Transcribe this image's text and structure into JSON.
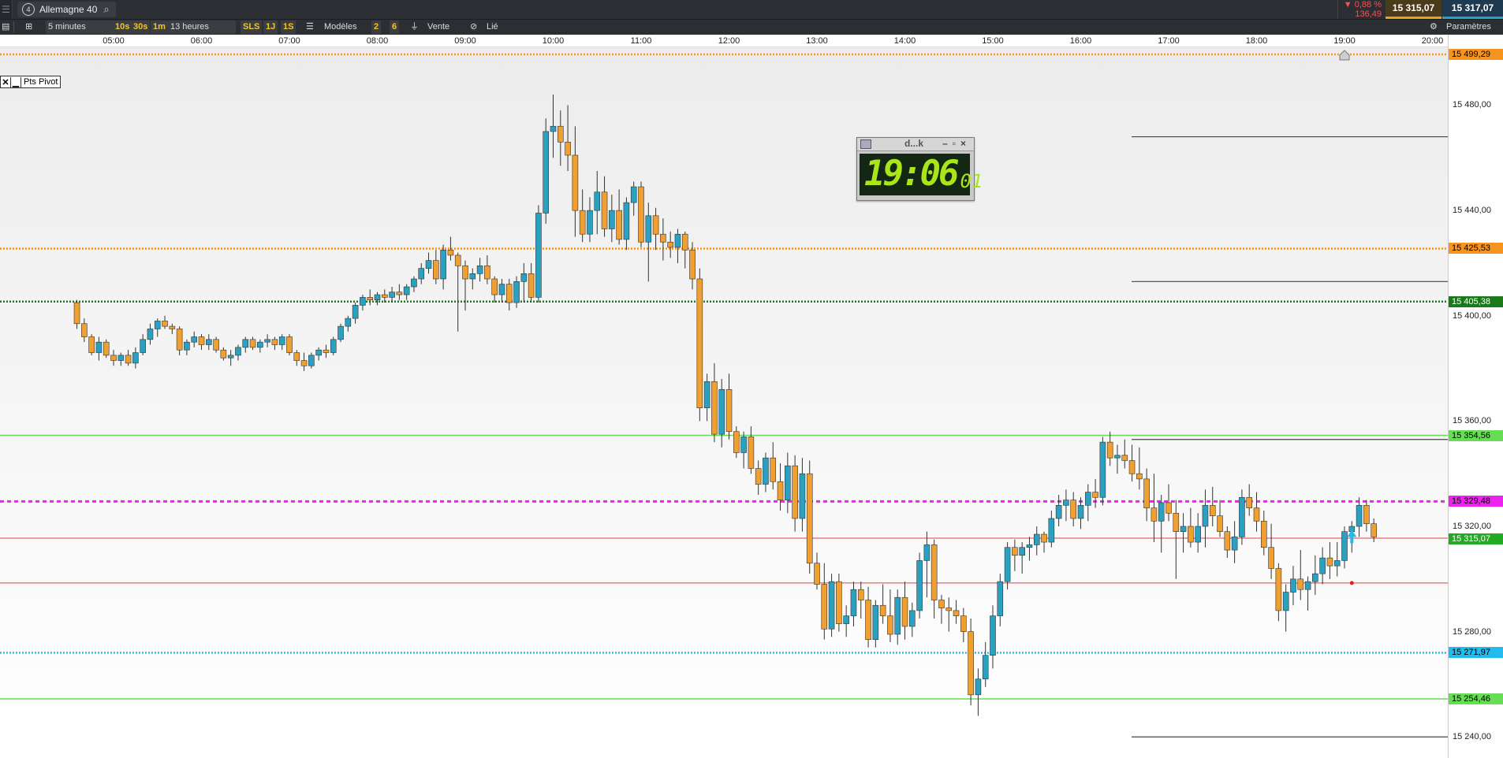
{
  "header": {
    "instrument": "Allemagne 40",
    "instrument_badge": "4",
    "change_pct": "▼ 0,88 %",
    "change_abs": "136,49",
    "bid": "15 315,07",
    "ask": "15 317,07"
  },
  "toolbar": {
    "timeframe": "5 minutes",
    "q10s": "10s",
    "q30s": "30s",
    "q1m": "1m",
    "duration": "13 heures",
    "sls": "SLS",
    "q1j": "1J",
    "q1s": "1S",
    "models": "Modèles",
    "n2": "2",
    "n6": "6",
    "sell": "Vente",
    "linked": "Lié",
    "settings": "Paramètres"
  },
  "pivot_legend": {
    "close": "✕",
    "minimize": "▁",
    "label": "Pts Pivot"
  },
  "clock": {
    "title": "d...k",
    "time": "19:06",
    "seconds": "01"
  },
  "colors": {
    "up": "#2aa1c0",
    "down": "#f0a030",
    "bullish_body": "#2aa1c0",
    "bearish_body": "#f0a030"
  },
  "chart_data": {
    "type": "candlestick",
    "title": "Allemagne 40",
    "timeframe": "5 minutes",
    "x_ticks": [
      "05:00",
      "06:00",
      "07:00",
      "08:00",
      "09:00",
      "10:00",
      "11:00",
      "12:00",
      "13:00",
      "14:00",
      "15:00",
      "16:00",
      "17:00",
      "18:00",
      "19:00",
      "20:00"
    ],
    "y_ticks": [
      "15 480,00",
      "15 440,00",
      "15 400,00",
      "15 360,00",
      "15 320,00",
      "15 280,00",
      "15 240,00"
    ],
    "ylim": [
      15232,
      15502
    ],
    "levels": [
      {
        "label": "15 499,29",
        "value": 15499.29,
        "color": "#f7941d",
        "style": "dotted",
        "text": "#000"
      },
      {
        "label": "15 425,53",
        "value": 15425.53,
        "color": "#f7941d",
        "style": "dotted",
        "text": "#000"
      },
      {
        "label": "15 405,38",
        "value": 15405.38,
        "color": "#1a7a1a",
        "style": "dotted",
        "text": "#fff"
      },
      {
        "label": "15 354,56",
        "value": 15354.56,
        "color": "#66dd55",
        "style": "solid",
        "text": "#000"
      },
      {
        "label": "15 329,48",
        "value": 15329.48,
        "color": "#ee22ee",
        "style": "dashed",
        "text": "#000"
      },
      {
        "label": "15 315,07",
        "value": 15315.07,
        "color": "#22aa22",
        "style": "current",
        "text": "#fff"
      },
      {
        "label": "15 271,97",
        "value": 15271.97,
        "color": "#22bbee",
        "style": "dotted",
        "text": "#000"
      },
      {
        "label": "15 254,46",
        "value": 15254.46,
        "color": "#66dd55",
        "style": "solid",
        "text": "#000"
      }
    ],
    "hlines": [
      {
        "value": 15315.5,
        "color": "#e04040"
      },
      {
        "value": 15298.5,
        "color": "#e04040"
      }
    ],
    "forecast_lines": [
      15468,
      15413,
      15353,
      15240
    ],
    "candles": [
      [
        "04:35",
        15405,
        15406,
        15395,
        15397
      ],
      [
        "04:40",
        15397,
        15399,
        15390,
        15392
      ],
      [
        "04:45",
        15392,
        15393,
        15385,
        15386
      ],
      [
        "04:50",
        15386,
        15392,
        15383,
        15390
      ],
      [
        "04:55",
        15390,
        15391,
        15384,
        15385
      ],
      [
        "05:00",
        15385,
        15387,
        15381,
        15383
      ],
      [
        "05:05",
        15383,
        15386,
        15381,
        15385
      ],
      [
        "05:10",
        15385,
        15387,
        15381,
        15382
      ],
      [
        "05:15",
        15382,
        15388,
        15380,
        15386
      ],
      [
        "05:20",
        15386,
        15393,
        15385,
        15391
      ],
      [
        "05:25",
        15391,
        15397,
        15389,
        15395
      ],
      [
        "05:30",
        15395,
        15399,
        15392,
        15398
      ],
      [
        "05:35",
        15398,
        15400,
        15395,
        15396
      ],
      [
        "05:40",
        15396,
        15397,
        15393,
        15395
      ],
      [
        "05:45",
        15395,
        15396,
        15385,
        15387
      ],
      [
        "05:50",
        15387,
        15391,
        15385,
        15390
      ],
      [
        "05:55",
        15390,
        15394,
        15388,
        15392
      ],
      [
        "06:00",
        15392,
        15393,
        15387,
        15389
      ],
      [
        "06:05",
        15389,
        15393,
        15387,
        15391
      ],
      [
        "06:10",
        15391,
        15392,
        15386,
        15387
      ],
      [
        "06:15",
        15387,
        15388,
        15383,
        15384
      ],
      [
        "06:20",
        15384,
        15387,
        15381,
        15385
      ],
      [
        "06:25",
        15385,
        15389,
        15383,
        15388
      ],
      [
        "06:30",
        15388,
        15392,
        15386,
        15391
      ],
      [
        "06:35",
        15391,
        15392,
        15387,
        15388
      ],
      [
        "06:40",
        15388,
        15391,
        15386,
        15390
      ],
      [
        "06:45",
        15390,
        15393,
        15388,
        15391
      ],
      [
        "06:50",
        15391,
        15392,
        15387,
        15389
      ],
      [
        "06:55",
        15389,
        15393,
        15387,
        15392
      ],
      [
        "07:00",
        15392,
        15393,
        15385,
        15386
      ],
      [
        "07:05",
        15386,
        15387,
        15381,
        15383
      ],
      [
        "07:10",
        15383,
        15386,
        15379,
        15381
      ],
      [
        "07:15",
        15381,
        15386,
        15380,
        15385
      ],
      [
        "07:20",
        15385,
        15388,
        15383,
        15387
      ],
      [
        "07:25",
        15387,
        15389,
        15384,
        15386
      ],
      [
        "07:30",
        15386,
        15392,
        15385,
        15391
      ],
      [
        "07:35",
        15391,
        15397,
        15390,
        15396
      ],
      [
        "07:40",
        15396,
        15400,
        15394,
        15399
      ],
      [
        "07:45",
        15399,
        15405,
        15397,
        15404
      ],
      [
        "07:50",
        15404,
        15408,
        15402,
        15407
      ],
      [
        "07:55",
        15407,
        15410,
        15404,
        15406
      ],
      [
        "08:00",
        15406,
        15409,
        15404,
        15408
      ],
      [
        "08:05",
        15408,
        15410,
        15405,
        15407
      ],
      [
        "08:10",
        15407,
        15411,
        15405,
        15409
      ],
      [
        "08:15",
        15409,
        15412,
        15406,
        15408
      ],
      [
        "08:20",
        15408,
        15412,
        15406,
        15411
      ],
      [
        "08:25",
        15411,
        15415,
        15409,
        15414
      ],
      [
        "08:30",
        15414,
        15420,
        15412,
        15418
      ],
      [
        "08:35",
        15418,
        15424,
        15416,
        15421
      ],
      [
        "08:40",
        15421,
        15425,
        15412,
        15414
      ],
      [
        "08:45",
        15414,
        15427,
        15410,
        15425
      ],
      [
        "08:50",
        15425,
        15430,
        15421,
        15423
      ],
      [
        "08:55",
        15423,
        15424,
        15394,
        15419
      ],
      [
        "09:00",
        15419,
        15421,
        15402,
        15414
      ],
      [
        "09:05",
        15414,
        15418,
        15410,
        15416
      ],
      [
        "09:10",
        15416,
        15422,
        15413,
        15419
      ],
      [
        "09:15",
        15419,
        15423,
        15412,
        15414
      ],
      [
        "09:20",
        15414,
        15415,
        15405,
        15408
      ],
      [
        "09:25",
        15408,
        15414,
        15405,
        15412
      ],
      [
        "09:30",
        15412,
        15414,
        15402,
        15405
      ],
      [
        "09:35",
        15405,
        15415,
        15403,
        15413
      ],
      [
        "09:40",
        15413,
        15420,
        15405,
        15416
      ],
      [
        "09:45",
        15416,
        15420,
        15405,
        15407
      ],
      [
        "09:50",
        15407,
        15442,
        15405,
        15439
      ],
      [
        "09:55",
        15439,
        15475,
        15435,
        15470
      ],
      [
        "10:00",
        15470,
        15484,
        15460,
        15472
      ],
      [
        "10:05",
        15472,
        15478,
        15457,
        15466
      ],
      [
        "10:10",
        15466,
        15480,
        15455,
        15461
      ],
      [
        "10:15",
        15461,
        15472,
        15430,
        15440
      ],
      [
        "10:20",
        15440,
        15448,
        15428,
        15431
      ],
      [
        "10:25",
        15431,
        15445,
        15428,
        15440
      ],
      [
        "10:30",
        15440,
        15455,
        15431,
        15447
      ],
      [
        "10:35",
        15447,
        15453,
        15430,
        15433
      ],
      [
        "10:40",
        15433,
        15446,
        15428,
        15440
      ],
      [
        "10:45",
        15440,
        15448,
        15427,
        15429
      ],
      [
        "10:50",
        15429,
        15445,
        15425,
        15443
      ],
      [
        "10:55",
        15443,
        15451,
        15438,
        15449
      ],
      [
        "11:00",
        15449,
        15451,
        15426,
        15428
      ],
      [
        "11:05",
        15428,
        15443,
        15413,
        15438
      ],
      [
        "11:10",
        15438,
        15441,
        15425,
        15431
      ],
      [
        "11:15",
        15431,
        15437,
        15421,
        15428
      ],
      [
        "11:20",
        15428,
        15432,
        15422,
        15426
      ],
      [
        "11:25",
        15426,
        15433,
        15420,
        15431
      ],
      [
        "11:30",
        15431,
        15432,
        15418,
        15425
      ],
      [
        "11:35",
        15425,
        15428,
        15410,
        15414
      ],
      [
        "11:40",
        15414,
        15418,
        15360,
        15365
      ],
      [
        "11:45",
        15365,
        15378,
        15360,
        15375
      ],
      [
        "11:50",
        15375,
        15382,
        15352,
        15355
      ],
      [
        "11:55",
        15355,
        15376,
        15350,
        15372
      ],
      [
        "12:00",
        15372,
        15378,
        15353,
        15356
      ],
      [
        "12:05",
        15356,
        15358,
        15346,
        15348
      ],
      [
        "12:10",
        15348,
        15356,
        15342,
        15354
      ],
      [
        "12:15",
        15354,
        15358,
        15340,
        15342
      ],
      [
        "12:20",
        15342,
        15345,
        15332,
        15336
      ],
      [
        "12:25",
        15336,
        15348,
        15333,
        15346
      ],
      [
        "12:30",
        15346,
        15352,
        15334,
        15337
      ],
      [
        "12:35",
        15337,
        15344,
        15326,
        15330
      ],
      [
        "12:40",
        15330,
        15348,
        15325,
        15343
      ],
      [
        "12:45",
        15343,
        15347,
        15318,
        15323
      ],
      [
        "12:50",
        15323,
        15346,
        15318,
        15340
      ],
      [
        "12:55",
        15340,
        15345,
        15302,
        15306
      ],
      [
        "13:00",
        15306,
        15310,
        15296,
        15298
      ],
      [
        "13:05",
        15298,
        15306,
        15277,
        15281
      ],
      [
        "13:10",
        15281,
        15302,
        15278,
        15299
      ],
      [
        "13:15",
        15299,
        15302,
        15280,
        15283
      ],
      [
        "13:20",
        15283,
        15290,
        15278,
        15286
      ],
      [
        "13:25",
        15286,
        15299,
        15282,
        15296
      ],
      [
        "13:30",
        15296,
        15299,
        15285,
        15292
      ],
      [
        "13:35",
        15292,
        15297,
        15274,
        15277
      ],
      [
        "13:40",
        15277,
        15292,
        15274,
        15290
      ],
      [
        "13:45",
        15290,
        15298,
        15283,
        15286
      ],
      [
        "13:50",
        15286,
        15296,
        15276,
        15279
      ],
      [
        "13:55",
        15279,
        15296,
        15275,
        15293
      ],
      [
        "14:00",
        15293,
        15299,
        15277,
        15282
      ],
      [
        "14:05",
        15282,
        15291,
        15278,
        15288
      ],
      [
        "14:10",
        15288,
        15310,
        15285,
        15307
      ],
      [
        "14:15",
        15307,
        15318,
        15293,
        15313
      ],
      [
        "14:20",
        15313,
        15315,
        15285,
        15292
      ],
      [
        "14:25",
        15292,
        15294,
        15283,
        15289
      ],
      [
        "14:30",
        15289,
        15293,
        15280,
        15288
      ],
      [
        "14:35",
        15288,
        15292,
        15283,
        15286
      ],
      [
        "14:40",
        15286,
        15289,
        15276,
        15280
      ],
      [
        "14:45",
        15280,
        15285,
        15252,
        15256
      ],
      [
        "14:50",
        15256,
        15266,
        15248,
        15262
      ],
      [
        "14:55",
        15262,
        15276,
        15259,
        15271
      ],
      [
        "15:00",
        15271,
        15290,
        15266,
        15286
      ],
      [
        "15:05",
        15286,
        15302,
        15282,
        15299
      ],
      [
        "15:10",
        15299,
        15314,
        15296,
        15312
      ],
      [
        "15:15",
        15312,
        15315,
        15303,
        15309
      ],
      [
        "15:20",
        15309,
        15314,
        15302,
        15312
      ],
      [
        "15:25",
        15312,
        15316,
        15307,
        15313
      ],
      [
        "15:30",
        15313,
        15320,
        15309,
        15317
      ],
      [
        "15:35",
        15317,
        15318,
        15310,
        15314
      ],
      [
        "15:40",
        15314,
        15326,
        15312,
        15323
      ],
      [
        "15:45",
        15323,
        15332,
        15320,
        15328
      ],
      [
        "15:50",
        15328,
        15334,
        15322,
        15330
      ],
      [
        "15:55",
        15330,
        15333,
        15320,
        15323
      ],
      [
        "16:00",
        15323,
        15331,
        15319,
        15328
      ],
      [
        "16:05",
        15328,
        15336,
        15322,
        15333
      ],
      [
        "16:10",
        15333,
        15338,
        15327,
        15331
      ],
      [
        "16:15",
        15331,
        15354,
        15328,
        15352
      ],
      [
        "16:20",
        15352,
        15356,
        15343,
        15346
      ],
      [
        "16:25",
        15346,
        15351,
        15340,
        15347
      ],
      [
        "16:30",
        15347,
        15353,
        15342,
        15345
      ],
      [
        "16:35",
        15345,
        15351,
        15337,
        15340
      ],
      [
        "16:40",
        15340,
        15350,
        15334,
        15338
      ],
      [
        "16:45",
        15338,
        15342,
        15322,
        15327
      ],
      [
        "16:50",
        15327,
        15340,
        15314,
        15322
      ],
      [
        "16:55",
        15322,
        15332,
        15310,
        15329
      ],
      [
        "17:00",
        15329,
        15336,
        15322,
        15325
      ],
      [
        "17:05",
        15325,
        15330,
        15300,
        15318
      ],
      [
        "17:10",
        15318,
        15325,
        15310,
        15320
      ],
      [
        "17:15",
        15320,
        15327,
        15312,
        15314
      ],
      [
        "17:20",
        15314,
        15325,
        15310,
        15320
      ],
      [
        "17:25",
        15320,
        15334,
        15312,
        15328
      ],
      [
        "17:30",
        15328,
        15335,
        15320,
        15324
      ],
      [
        "17:35",
        15324,
        15330,
        15316,
        15318
      ],
      [
        "17:40",
        15318,
        15320,
        15308,
        15311
      ],
      [
        "17:45",
        15311,
        15322,
        15306,
        15316
      ],
      [
        "17:50",
        15316,
        15334,
        15313,
        15331
      ],
      [
        "17:55",
        15331,
        15336,
        15324,
        15327
      ],
      [
        "18:00",
        15327,
        15333,
        15318,
        15322
      ],
      [
        "18:05",
        15322,
        15326,
        15309,
        15312
      ],
      [
        "18:10",
        15312,
        15321,
        15300,
        15304
      ],
      [
        "18:15",
        15304,
        15306,
        15284,
        15288
      ],
      [
        "18:20",
        15288,
        15298,
        15280,
        15295
      ],
      [
        "18:25",
        15295,
        15305,
        15290,
        15300
      ],
      [
        "18:30",
        15300,
        15311,
        15292,
        15296
      ],
      [
        "18:35",
        15296,
        15301,
        15288,
        15299
      ],
      [
        "18:40",
        15299,
        15309,
        15294,
        15302
      ],
      [
        "18:45",
        15302,
        15312,
        15298,
        15308
      ],
      [
        "18:50",
        15308,
        15314,
        15300,
        15305
      ],
      [
        "18:55",
        15305,
        15314,
        15301,
        15307
      ],
      [
        "19:00",
        15307,
        15320,
        15304,
        15318
      ],
      [
        "19:05",
        15318,
        15322,
        15310,
        15320
      ],
      [
        "19:10",
        15320,
        15331,
        15316,
        15328
      ],
      [
        "19:15",
        15328,
        15330,
        15318,
        15321
      ],
      [
        "19:20",
        15321,
        15323,
        15314,
        15316
      ]
    ],
    "start_time": "04:35",
    "minutes_per_candle": 5
  }
}
